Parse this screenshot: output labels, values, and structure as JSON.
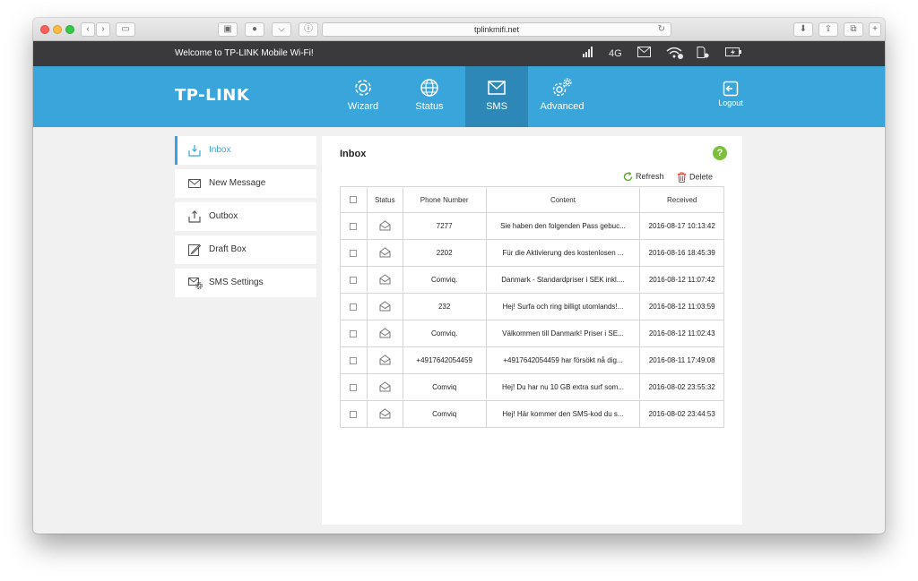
{
  "browser": {
    "url": "tplinkmifi.net"
  },
  "topbar": {
    "welcome": "Welcome to TP-LINK Mobile Wi-Fi!",
    "network_type": "4G"
  },
  "brand": {
    "logo": "TP-LINK",
    "accent_color": "#3aa5db"
  },
  "nav": {
    "items": [
      {
        "label": "Wizard",
        "icon": "gear-icon"
      },
      {
        "label": "Status",
        "icon": "globe-icon"
      },
      {
        "label": "SMS",
        "icon": "envelope-icon"
      },
      {
        "label": "Advanced",
        "icon": "gears-icon"
      }
    ],
    "logout": "Logout"
  },
  "sidebar": {
    "items": [
      {
        "label": "Inbox",
        "icon": "inbox-icon"
      },
      {
        "label": "New Message",
        "icon": "envelope-icon"
      },
      {
        "label": "Outbox",
        "icon": "outbox-icon"
      },
      {
        "label": "Draft Box",
        "icon": "draft-icon"
      },
      {
        "label": "SMS Settings",
        "icon": "sms-settings-icon"
      }
    ]
  },
  "panel": {
    "title": "Inbox",
    "help": "?",
    "refresh_label": "Refresh",
    "delete_label": "Delete"
  },
  "table": {
    "headers": [
      "Status",
      "Phone Number",
      "Content",
      "Received"
    ],
    "rows": [
      {
        "phone": "7277",
        "content": "Sie haben den folgenden Pass gebuc...",
        "received": "2016-08-17 10:13:42"
      },
      {
        "phone": "2202",
        "content": "Für die Aktivierung des kostenlosen ...",
        "received": "2016-08-16 18:45:39"
      },
      {
        "phone": "Comviq.",
        "content": "Danmark - Standardpriser i SEK inkl....",
        "received": "2016-08-12 11:07:42"
      },
      {
        "phone": "232",
        "content": "Hej! Surfa och ring billigt utomlands!...",
        "received": "2016-08-12 11:03:59"
      },
      {
        "phone": "Comviq.",
        "content": "Välkommen till Danmark! Priser i SE...",
        "received": "2016-08-12 11:02:43"
      },
      {
        "phone": "+4917642054459",
        "content": "+4917642054459 har försökt nå dig...",
        "received": "2016-08-11 17:49:08"
      },
      {
        "phone": "Comviq",
        "content": "Hej! Du har nu 10 GB extra surf som...",
        "received": "2016-08-02 23:55:32"
      },
      {
        "phone": "Comviq",
        "content": "Hej! Här kommer den SMS-kod du s...",
        "received": "2016-08-02 23:44:53"
      }
    ]
  }
}
